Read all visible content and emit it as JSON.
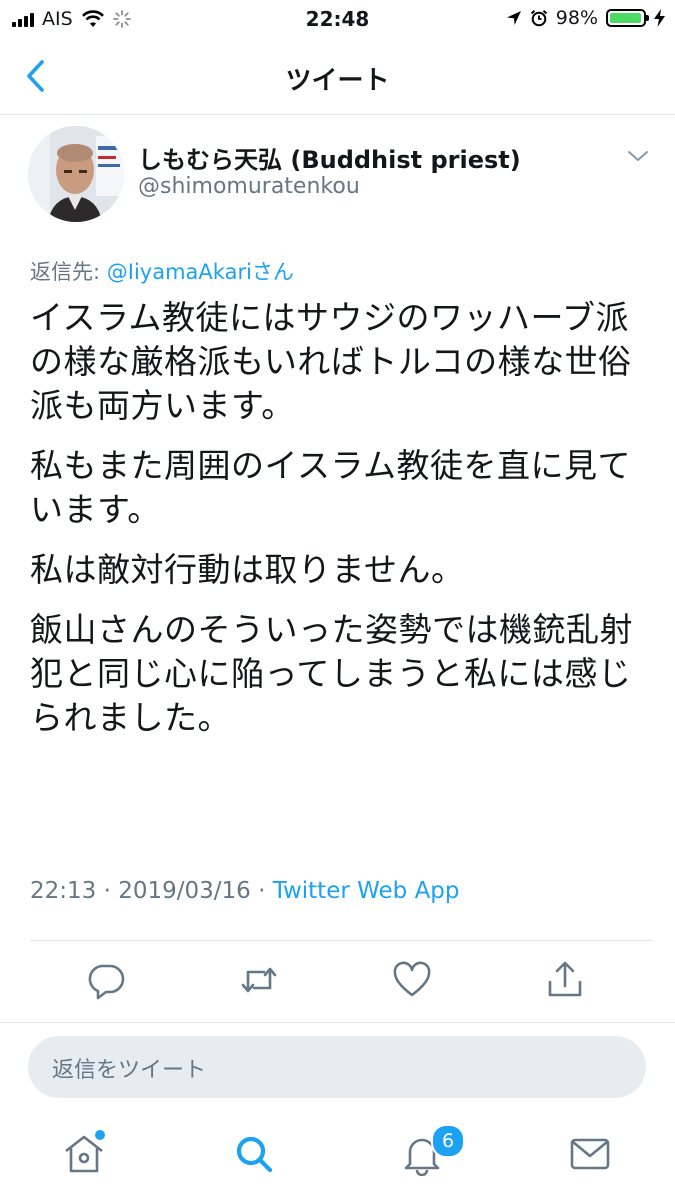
{
  "status_bar": {
    "carrier": "AIS",
    "time": "22:48",
    "battery_percent": "98%",
    "icons": [
      "signal-icon",
      "wifi-icon",
      "loading-icon",
      "location-icon",
      "alarm-icon",
      "battery-icon",
      "charging-icon"
    ]
  },
  "nav": {
    "title": "ツイート",
    "back_icon": "chevron-left-icon"
  },
  "tweet": {
    "display_name": "しもむら天弘 (Buddhist priest)",
    "handle": "@shimomuratenkou",
    "reply_prefix": "返信先: ",
    "reply_mention": "@IiyamaAkari",
    "reply_suffix": "さん",
    "paragraphs": [
      "イスラム教徒にはサウジのワッハーブ派の様な厳格派もいればトルコの様な世俗派も両方います。",
      "私もまた周囲のイスラム教徒を直に見ています。",
      "私は敵対行動は取りません。",
      "飯山さんのそういった姿勢では機銃乱射犯と同じ心に陥ってしまうと私には感じられました。"
    ],
    "timestamp": "22:13 · 2019/03/16 · ",
    "source_app": "Twitter Web App"
  },
  "actions": {
    "icons": [
      "reply-icon",
      "retweet-icon",
      "like-icon",
      "share-icon"
    ]
  },
  "reply_box": {
    "placeholder": "返信をツイート"
  },
  "tab_bar": {
    "items": [
      "home-icon",
      "search-icon",
      "notifications-icon",
      "messages-icon"
    ],
    "notifications_badge": "6"
  },
  "colors": {
    "accent": "#1da1f2",
    "secondary_text": "#657786",
    "divider": "#e1e8ed"
  }
}
